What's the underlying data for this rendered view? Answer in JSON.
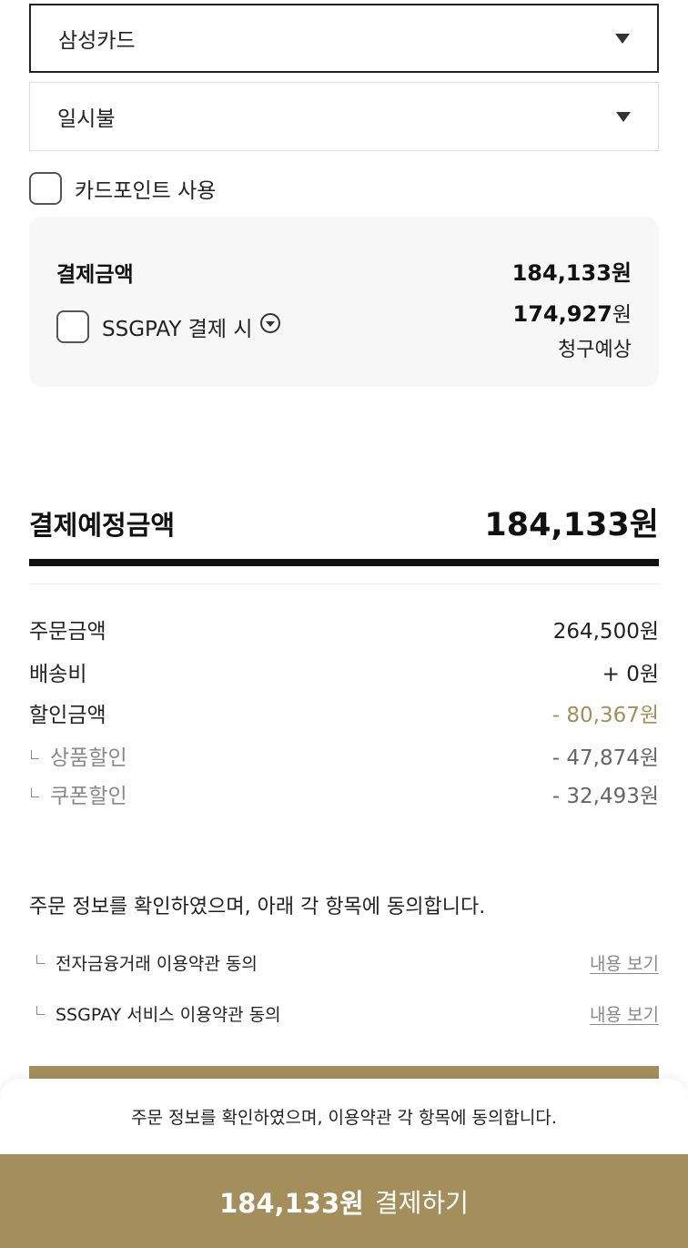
{
  "card_select": {
    "value": "삼성카드"
  },
  "installment_select": {
    "value": "일시불"
  },
  "card_point": {
    "label": "카드포인트 사용"
  },
  "payment_box": {
    "title": "결제금액",
    "amount": "184,133원",
    "ssgpay_label": "SSGPAY 결제 시",
    "estimate_number": "174,927",
    "estimate_unit": "원",
    "estimate_caption": "청구예상"
  },
  "summary": {
    "title": "결제예정금액",
    "total": "184,133원",
    "rows": [
      {
        "label": "주문금액",
        "value": "264,500원"
      },
      {
        "label": "배송비",
        "value": "+ 0원"
      },
      {
        "label": "할인금액",
        "value": "- 80,367원"
      },
      {
        "label": "상품할인",
        "value": "- 47,874원"
      },
      {
        "label": "쿠폰할인",
        "value": "- 32,493원"
      }
    ]
  },
  "agreement": {
    "text": "주문 정보를 확인하였으며, 아래 각 항목에 동의합니다.",
    "terms": [
      {
        "label": "전자금융거래 이용약관 동의",
        "link": "내용 보기"
      },
      {
        "label": "SSGPAY 서비스 이용약관 동의",
        "link": "내용 보기"
      }
    ]
  },
  "bottom_sheet": {
    "notice": "주문 정보를 확인하였으며, 이용약관 각 항목에 동의합니다.",
    "pay_amount": "184,133원",
    "pay_label": "결제하기"
  },
  "colors": {
    "accent_gold": "#a48f5c",
    "dark": "#111111"
  }
}
